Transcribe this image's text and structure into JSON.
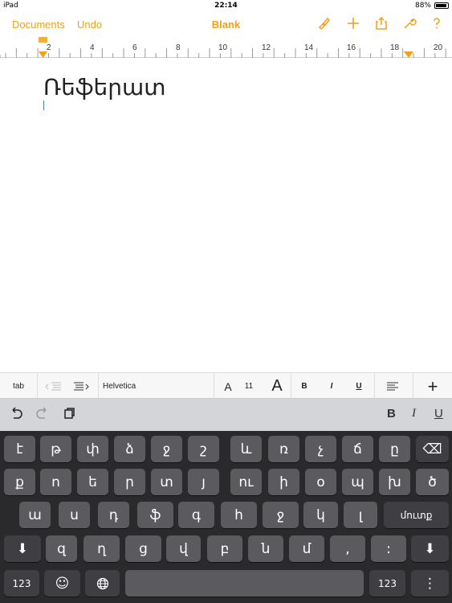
{
  "status": {
    "device": "iPad",
    "time": "22:14",
    "battery": "88%"
  },
  "toolbar": {
    "documents": "Documents",
    "undo": "Undo",
    "title": "Blank",
    "icons": [
      "paintbrush-icon",
      "plus-icon",
      "share-icon",
      "wrench-icon",
      "help-icon"
    ]
  },
  "ruler": {
    "labels": [
      "2",
      "4",
      "6",
      "8",
      "10",
      "12",
      "14",
      "16",
      "18",
      "20"
    ]
  },
  "document": {
    "text": "Ռեֆերատ"
  },
  "format_bar": {
    "tab": "tab",
    "font": "Helvetica",
    "size_small": "A",
    "size": "11",
    "size_large": "A",
    "bold": "B",
    "italic": "I",
    "underline": "U",
    "plus": "+"
  },
  "shortcut_bar": {
    "bold": "B",
    "italic": "I",
    "underline": "U"
  },
  "keyboard": {
    "row1": [
      "է",
      "թ",
      "փ",
      "ձ",
      "ջ",
      "շ",
      "և",
      "ռ",
      "չ",
      "ճ",
      "ը",
      "⌫"
    ],
    "row2": [
      "ք",
      "ո",
      "ե",
      "ր",
      "տ",
      "յ",
      "ու",
      "ի",
      "օ",
      "պ",
      "խ",
      "ծ"
    ],
    "row3": [
      "ա",
      "ս",
      "դ",
      "ֆ",
      "գ",
      "հ",
      "ջ",
      "կ",
      "լ",
      "մուտք"
    ],
    "row4": [
      "⬇",
      "զ",
      "ղ",
      "ց",
      "վ",
      "բ",
      "ն",
      "մ",
      ",",
      ":",
      "⬇"
    ],
    "row5": {
      "num_left": "123",
      "emoji": "☺",
      "globe": "🌐",
      "num_right": "123",
      "dismiss": "⋮"
    }
  }
}
